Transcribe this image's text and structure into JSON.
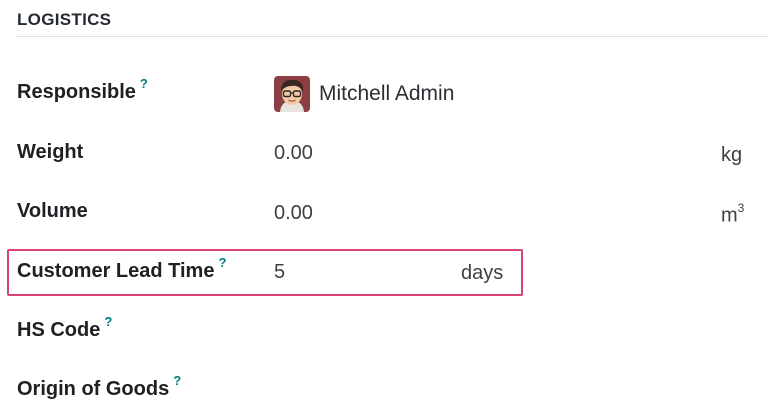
{
  "section": {
    "title": "LOGISTICS"
  },
  "fields": {
    "responsible": {
      "label": "Responsible",
      "help": "?",
      "value": "Mitchell Admin",
      "avatar_icon": "user-avatar-glasses-icon"
    },
    "weight": {
      "label": "Weight",
      "value": "0.00",
      "unit": "kg"
    },
    "volume": {
      "label": "Volume",
      "value": "0.00",
      "unit_base": "m",
      "unit_exp": "3"
    },
    "customer_lead_time": {
      "label": "Customer Lead Time",
      "help": "?",
      "value": "5",
      "unit": "days",
      "highlight_color": "#d9436f"
    },
    "hs_code": {
      "label": "HS Code",
      "help": "?",
      "value": ""
    },
    "origin_of_goods": {
      "label": "Origin of Goods",
      "help": "?",
      "value": ""
    }
  },
  "colors": {
    "help_icon": "#017e84",
    "divider": "#dee2e6"
  }
}
